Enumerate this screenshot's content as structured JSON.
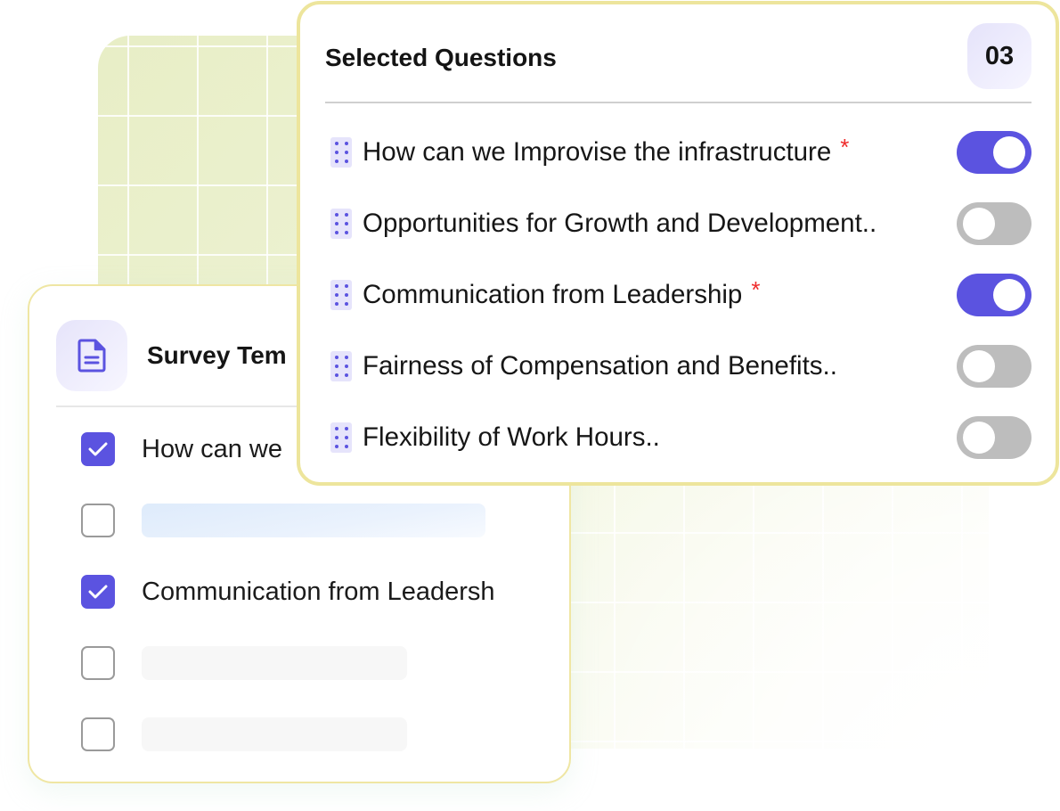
{
  "colors": {
    "accent": "#5b53e0",
    "required": "#ef2b2b",
    "toggle_off": "#bdbdbd",
    "card_border": "#ede59c"
  },
  "survey_card": {
    "title": "Survey Tem",
    "icon": "document-icon",
    "items": [
      {
        "checked": true,
        "text": "How can we",
        "placeholder": false
      },
      {
        "checked": false,
        "text": "",
        "placeholder": "blue"
      },
      {
        "checked": true,
        "text": "Communication from Leadersh",
        "placeholder": false
      },
      {
        "checked": false,
        "text": "",
        "placeholder": "gray"
      },
      {
        "checked": false,
        "text": "",
        "placeholder": "gray"
      }
    ]
  },
  "selected_card": {
    "title": "Selected Questions",
    "count": "03",
    "questions": [
      {
        "text": "How can we Improvise the infrastructure",
        "required": true,
        "enabled": true
      },
      {
        "text": "Opportunities for Growth and Development..",
        "required": false,
        "enabled": false
      },
      {
        "text": "Communication from Leadership",
        "required": true,
        "enabled": true
      },
      {
        "text": "Fairness of Compensation and Benefits..",
        "required": false,
        "enabled": false
      },
      {
        "text": "Flexibility of Work Hours..",
        "required": false,
        "enabled": false
      }
    ],
    "required_marker": "*"
  }
}
